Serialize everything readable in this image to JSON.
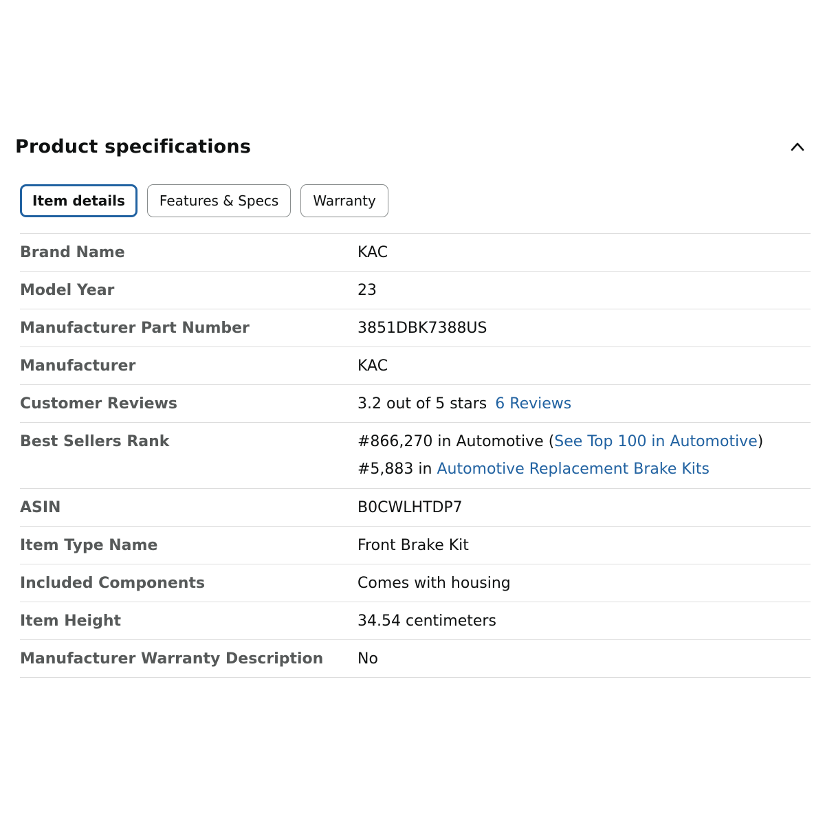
{
  "section": {
    "title": "Product specifications",
    "toggle_icon": "chevron-up-icon"
  },
  "tabs": [
    {
      "label": "Item details",
      "active": true
    },
    {
      "label": "Features & Specs",
      "active": false
    },
    {
      "label": "Warranty",
      "active": false
    }
  ],
  "specs": {
    "brand_name": {
      "label": "Brand Name",
      "value": "KAC"
    },
    "model_year": {
      "label": "Model Year",
      "value": "23"
    },
    "part_number": {
      "label": "Manufacturer Part Number",
      "value": "3851DBK7388US"
    },
    "manufacturer": {
      "label": "Manufacturer",
      "value": "KAC"
    },
    "customer_reviews": {
      "label": "Customer Reviews",
      "rating_text": "3.2 out of 5 stars",
      "reviews_count": "6",
      "reviews_word": "Reviews",
      "rating_value": 3.2,
      "rating_max": 5
    },
    "best_sellers_rank": {
      "label": "Best Sellers Rank",
      "rank1_text": "#866,270 in Automotive (",
      "rank1_link": "See Top 100 in Automotive",
      "rank1_close": ")",
      "rank2_text": "#5,883 in ",
      "rank2_link": "Automotive Replacement Brake Kits"
    },
    "asin": {
      "label": "ASIN",
      "value": "B0CWLHTDP7"
    },
    "item_type": {
      "label": "Item Type Name",
      "value": "Front Brake Kit"
    },
    "included_components": {
      "label": "Included Components",
      "value": "Comes with housing"
    },
    "item_height": {
      "label": "Item Height",
      "value": "34.54 centimeters"
    },
    "warranty_description": {
      "label": "Manufacturer Warranty Description",
      "value": "No"
    }
  },
  "colors": {
    "link": "#2162a1",
    "active_tab_border": "#2162a1",
    "label_text": "#565959",
    "divider": "#dddddd"
  }
}
